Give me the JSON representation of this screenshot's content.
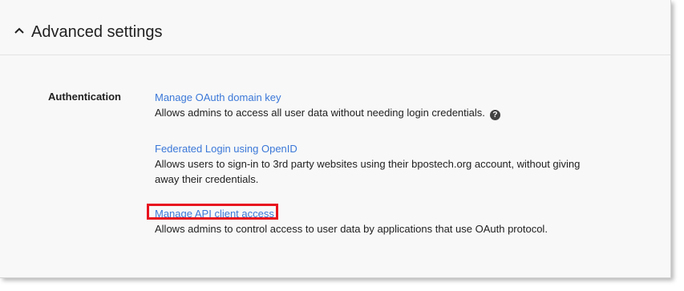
{
  "section": {
    "title": "Advanced settings",
    "collapse_icon": "chevron-up-icon"
  },
  "authentication": {
    "label": "Authentication",
    "settings": [
      {
        "link": "Manage OAuth domain key",
        "description": "Allows admins to access all user data without needing login credentials.",
        "help_icon": "help-circle-icon"
      },
      {
        "link": "Federated Login using OpenID",
        "description": "Allows users to sign-in to 3rd party websites using their bpostech.org account, without giving away their credentials."
      },
      {
        "link": "Manage API client access",
        "description": "Allows admins to control access to user data by applications that use OAuth protocol.",
        "highlighted": true,
        "highlight_color": "#e8121e"
      }
    ]
  },
  "colors": {
    "link": "#3b78d8",
    "text": "#212121",
    "card_background": "#f8f8f8"
  }
}
